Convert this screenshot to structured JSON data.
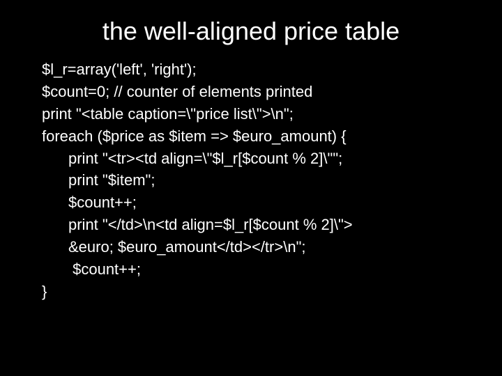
{
  "title": "the well-aligned price table",
  "code": {
    "l1": "$l_r=array('left', 'right');",
    "l2": "$count=0; // counter of elements printed",
    "l3": "print \"<table caption=\\\"price list\\\">\\n\";",
    "l4": "foreach ($price as $item => $euro_amount) {",
    "l5": "print \"<tr><td align=\\\"$l_r[$count % 2]\\\"\";",
    "l6": "print \"$item\";",
    "l7": "$count++;",
    "l8": "print \"</td>\\n<td align=$l_r[$count % 2]\\\">",
    "l9": "&euro; $euro_amount</td></tr>\\n\";",
    "l10": " $count++;",
    "l11": "}"
  }
}
